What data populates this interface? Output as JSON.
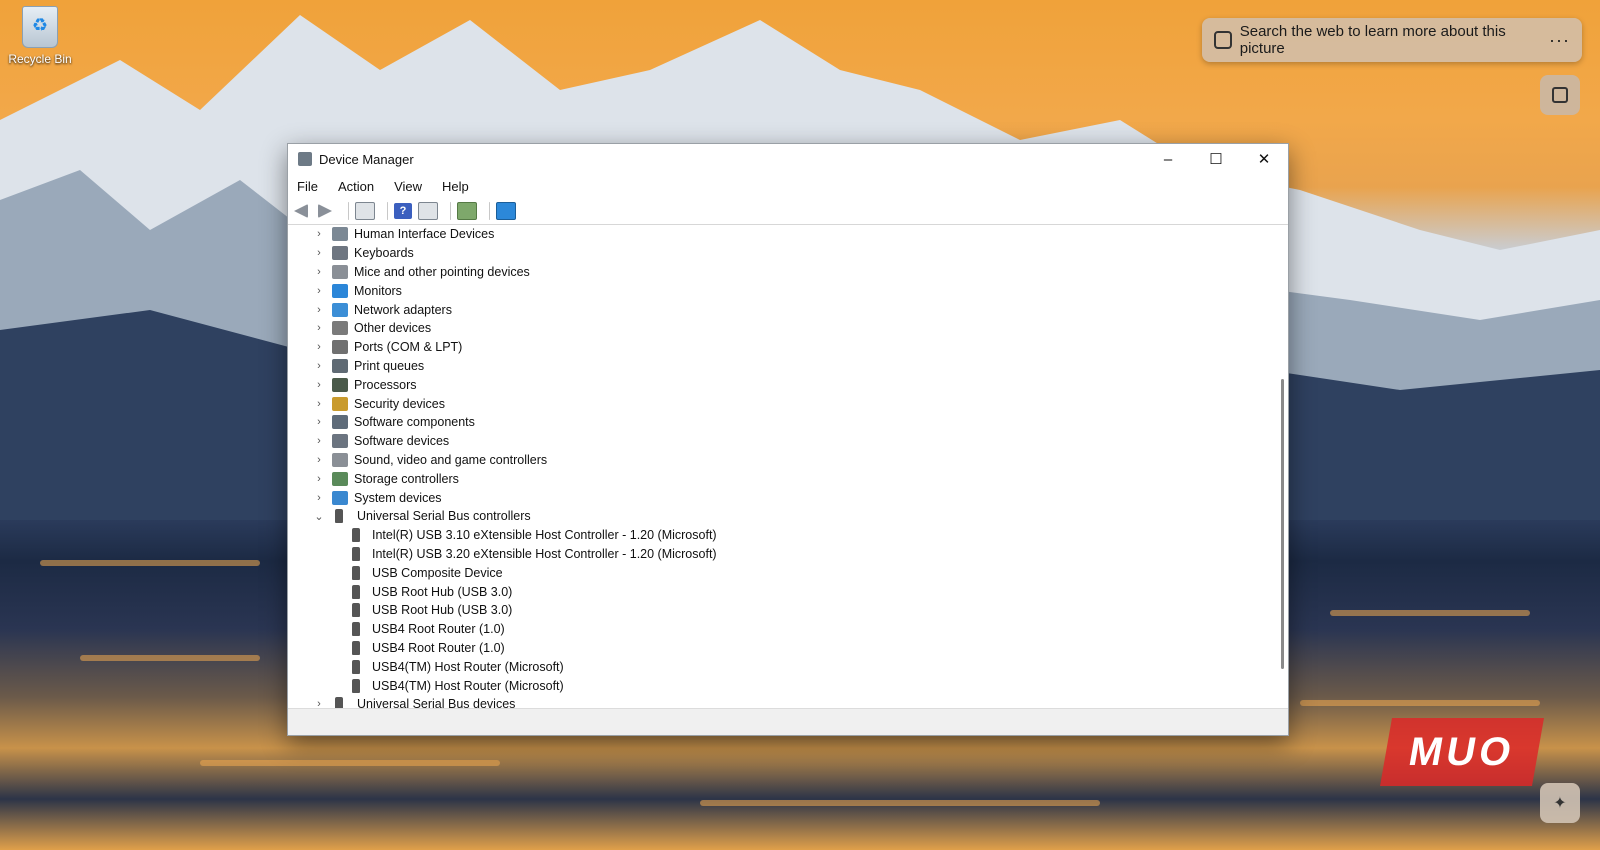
{
  "desktop": {
    "recycle_bin_label": "Recycle Bin",
    "search_pill_text": "Search the web to learn more about this picture",
    "search_pill_more": "···",
    "watermark": "MUO"
  },
  "window": {
    "title": "Device Manager",
    "menu": [
      "File",
      "Action",
      "View",
      "Help"
    ],
    "controls": {
      "minimize": "–",
      "maximize": "☐",
      "close": "✕"
    }
  },
  "tree": {
    "categories": [
      {
        "label": "Human Interface Devices",
        "icon_color": "#7b8894"
      },
      {
        "label": "Keyboards",
        "icon_color": "#6e7681"
      },
      {
        "label": "Mice and other pointing devices",
        "icon_color": "#8a8f96"
      },
      {
        "label": "Monitors",
        "icon_color": "#2b86d8"
      },
      {
        "label": "Network adapters",
        "icon_color": "#3b8ed6"
      },
      {
        "label": "Other devices",
        "icon_color": "#7a7a7a"
      },
      {
        "label": "Ports (COM & LPT)",
        "icon_color": "#707070"
      },
      {
        "label": "Print queues",
        "icon_color": "#5f6a74"
      },
      {
        "label": "Processors",
        "icon_color": "#4a5a4a"
      },
      {
        "label": "Security devices",
        "icon_color": "#c99b2e"
      },
      {
        "label": "Software components",
        "icon_color": "#5e6b79"
      },
      {
        "label": "Software devices",
        "icon_color": "#6b7480"
      },
      {
        "label": "Sound, video and game controllers",
        "icon_color": "#8a8f96"
      },
      {
        "label": "Storage controllers",
        "icon_color": "#5a8a5a"
      },
      {
        "label": "System devices",
        "icon_color": "#3a88d0"
      }
    ],
    "expanded": {
      "label": "Universal Serial Bus controllers",
      "children": [
        "Intel(R) USB 3.10 eXtensible Host Controller - 1.20 (Microsoft)",
        "Intel(R) USB 3.20 eXtensible Host Controller - 1.20 (Microsoft)",
        "USB Composite Device",
        "USB Root Hub (USB 3.0)",
        "USB Root Hub (USB 3.0)",
        "USB4 Root Router (1.0)",
        "USB4 Root Router (1.0)",
        "USB4(TM) Host Router (Microsoft)",
        "USB4(TM) Host Router (Microsoft)"
      ]
    },
    "last": {
      "label": "Universal Serial Bus devices"
    }
  }
}
